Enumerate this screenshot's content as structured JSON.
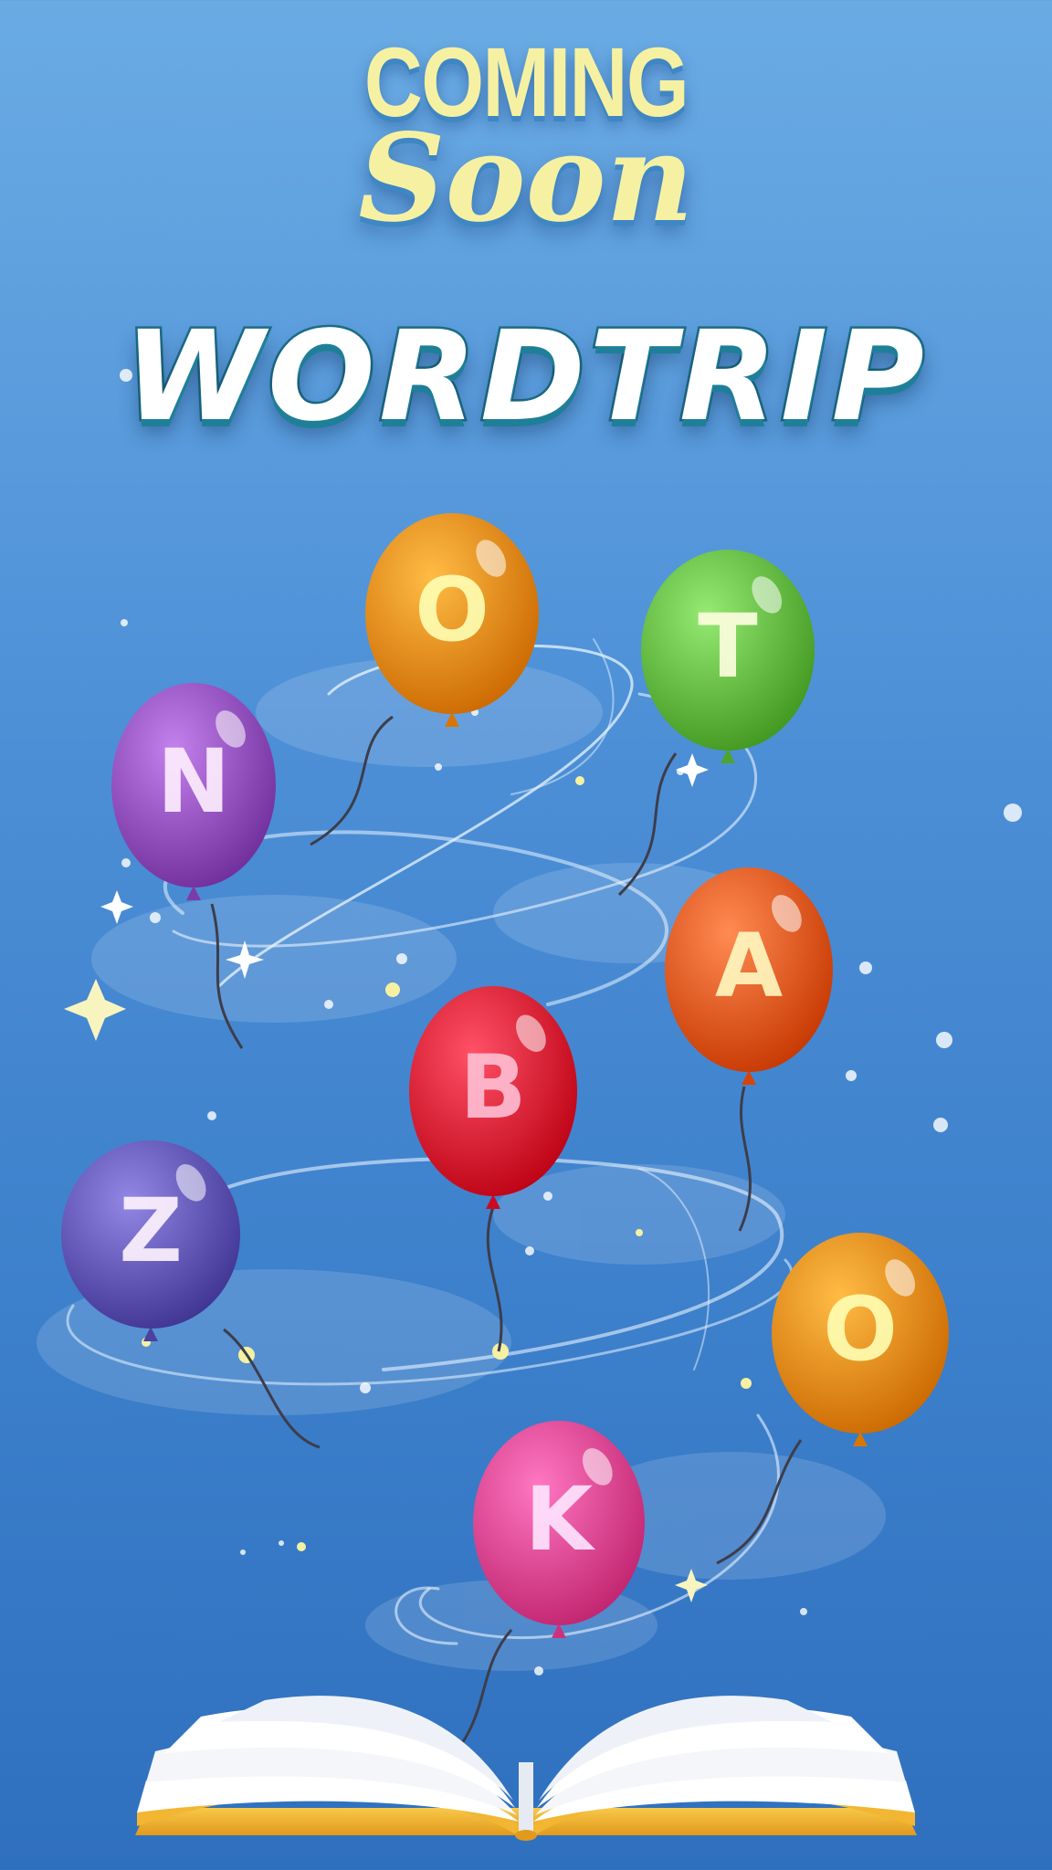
{
  "header": {
    "line1": "COMING",
    "line2": "Soon"
  },
  "game_title": "WORDTRIP",
  "balloons": [
    {
      "letter": "O",
      "color": "#f7941d"
    },
    {
      "letter": "T",
      "color": "#6cc24a"
    },
    {
      "letter": "N",
      "color": "#9b59c6"
    },
    {
      "letter": "A",
      "color": "#f2632a"
    },
    {
      "letter": "B",
      "color": "#e8293f"
    },
    {
      "letter": "Z",
      "color": "#6a5fbd"
    },
    {
      "letter": "O",
      "color": "#f7941d"
    },
    {
      "letter": "K",
      "color": "#ec4f9a"
    }
  ],
  "colors": {
    "title_yellow": "#f6f1a2",
    "book_edge": "#f2b632"
  }
}
